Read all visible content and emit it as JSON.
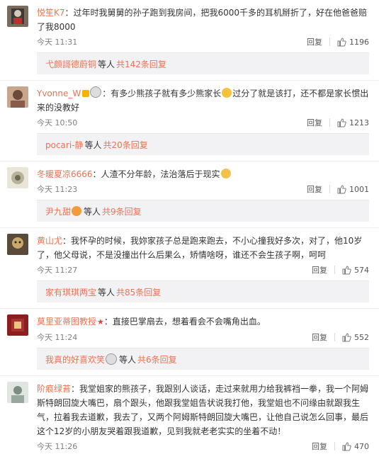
{
  "reply_label": "回复",
  "comments": [
    {
      "user": "悦笙K7",
      "text": "：过年时我舅舅的孙子跑到我房间，把我6000千多的耳机掰折了，好在他爸爸赔了我8000",
      "time": "今天 11:31",
      "likes": "1196",
      "sub_user": "弋颜謌德蔚铜",
      "sub_rest": "等人",
      "sub_count": "共142条回复"
    },
    {
      "user": "Yvonne_W",
      "text_a": "：有多少熊孩子就有多少熊家长",
      "text_b": "过分了就是该打，还不都是家长惯出来的没教好",
      "time": "今天 10:50",
      "likes": "1213",
      "sub_user": "pocari-静",
      "sub_rest": "等人",
      "sub_count": "共20条回复"
    },
    {
      "user": "冬暖夏凉6666",
      "text": "：人渣不分年龄，法治落后于现实",
      "time": "今天 11:23",
      "likes": "1001",
      "sub_user": "尹九甜",
      "sub_rest": "等人",
      "sub_count": "共9条回复"
    },
    {
      "user": "黄山尤",
      "text": "：我怀孕的时候，我妳家孩子总是跑来跑去，不小心撞我好多次，对了，他10岁了，他父母说，不是没撞出什么后果么，矫情啥呀，谁还不会生孩子啊，呵呵",
      "time": "今天 11:27",
      "likes": "574",
      "sub_user": "家有琪琪两宝",
      "sub_rest": "等人",
      "sub_count": "共85条回复"
    },
    {
      "user": "莫里亚蒂图教授",
      "text": "：直接巴掌扇去，想着看会不会嘴角出血。",
      "time": "今天 11:24",
      "likes": "552",
      "sub_user": "我真的好喜欢笑",
      "sub_rest": "等人",
      "sub_count": "共6条回复"
    },
    {
      "user": "阶痕绿苔",
      "text": "：我堂姐家的熊孩子，我跟别人谈话，走过来就用力给我裤裆一拳，我一个阿姆斯特朗回旋大嘴巴，扇个跟头，他跟我堂姐告状说我打他，我堂姐也不问缘由就跟我生气，拉着我去道歉，我去了，又两个阿姆斯特朗回旋大嘴巴，让他自己说怎么回事，最后这个12岁的小朋友哭着跟我道歉，见到我就老老实实的坐着不动！",
      "time": "今天 11:26",
      "likes": "470"
    }
  ]
}
